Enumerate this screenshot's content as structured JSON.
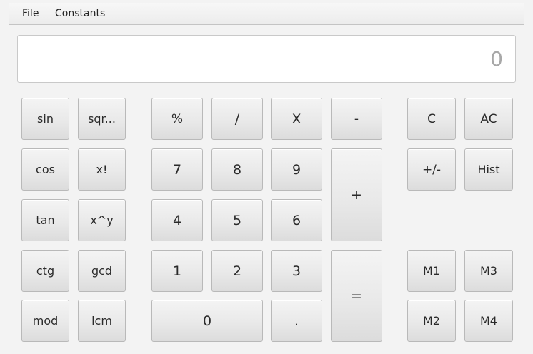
{
  "menu": {
    "file": "File",
    "constants": "Constants"
  },
  "display": {
    "value": "0"
  },
  "functions": {
    "sin": "sin",
    "sqrt": "sqr...",
    "cos": "cos",
    "factorial": "x!",
    "tan": "tan",
    "power": "x^y",
    "ctg": "ctg",
    "gcd": "gcd",
    "mod": "mod",
    "lcm": "lcm"
  },
  "operators": {
    "percent": "%",
    "divide": "/",
    "multiply": "X",
    "subtract": "-",
    "add": "+",
    "equals": "=",
    "decimal": "."
  },
  "digits": {
    "d0": "0",
    "d1": "1",
    "d2": "2",
    "d3": "3",
    "d4": "4",
    "d5": "5",
    "d6": "6",
    "d7": "7",
    "d8": "8",
    "d9": "9"
  },
  "controls": {
    "clear": "C",
    "all_clear": "AC",
    "negate": "+/-",
    "history": "Hist",
    "m1": "M1",
    "m2": "M2",
    "m3": "M3",
    "m4": "M4"
  }
}
